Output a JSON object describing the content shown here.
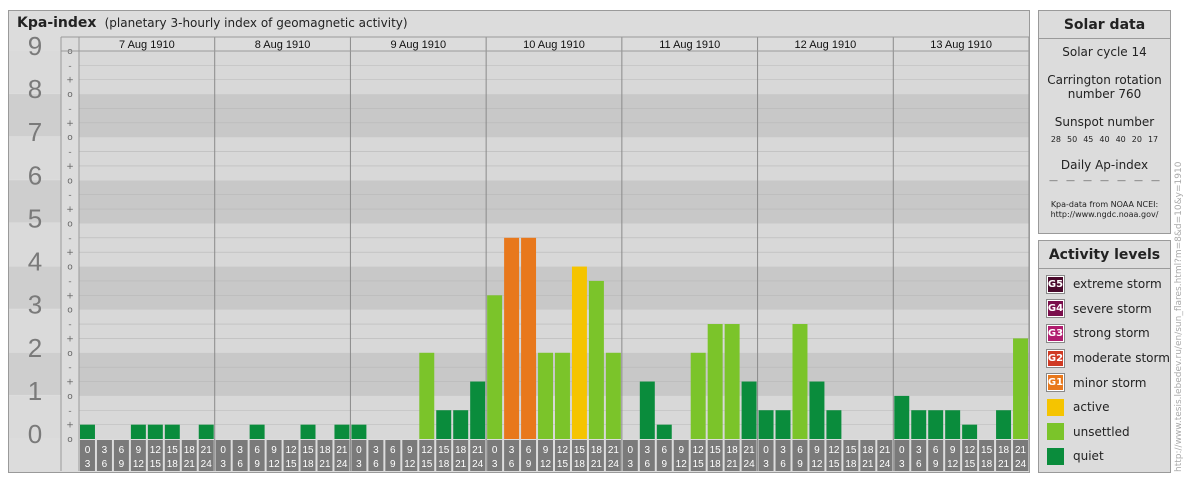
{
  "header": {
    "title": "Kpa-index",
    "subtitle": "(planetary 3-hourly index of geomagnetic activity)"
  },
  "chart_data": {
    "type": "bar",
    "title": "Kpa-index",
    "subtitle": "(planetary 3-hourly index of geomagnetic activity)",
    "ylim": [
      0,
      9
    ],
    "y_ticks": [
      "0",
      "1",
      "2",
      "3",
      "4",
      "5",
      "6",
      "7",
      "8",
      "9"
    ],
    "y_subticks": [
      "o",
      "+",
      "-"
    ],
    "days": [
      "7 Aug 1910",
      "8 Aug 1910",
      "9 Aug 1910",
      "10 Aug 1910",
      "11 Aug 1910",
      "12 Aug 1910",
      "13 Aug 1910"
    ],
    "interval_labels": [
      [
        "0",
        "3"
      ],
      [
        "3",
        "6"
      ],
      [
        "6",
        "9"
      ],
      [
        "9",
        "12"
      ],
      [
        "12",
        "15"
      ],
      [
        "15",
        "18"
      ],
      [
        "18",
        "21"
      ],
      [
        "21",
        "24"
      ]
    ],
    "values": [
      [
        0.333,
        0,
        0,
        0.333,
        0.333,
        0.333,
        0,
        0.333
      ],
      [
        0,
        0,
        0.333,
        0,
        0,
        0.333,
        0,
        0.333
      ],
      [
        0.333,
        0,
        0,
        0,
        2,
        0.667,
        0.667,
        1.333
      ],
      [
        3.333,
        4.667,
        4.667,
        2,
        2,
        4,
        3.667,
        2
      ],
      [
        0,
        1.333,
        0.333,
        0,
        2,
        2.667,
        2.667,
        1.333
      ],
      [
        0.667,
        0.667,
        2.667,
        1.333,
        0.667,
        0,
        0,
        0
      ],
      [
        1,
        0.667,
        0.667,
        0.667,
        0.333,
        0,
        0.667,
        2.333
      ]
    ],
    "colors": {
      "quiet": "#0a8c3c",
      "unsettled": "#7bc42a",
      "active": "#f5c400",
      "minor": "#e8781c"
    },
    "grid": true
  },
  "solar": {
    "title": "Solar data",
    "cycle": "Solar cycle 14",
    "carrington_line1": "Carrington rotation",
    "carrington_line2": "number 760",
    "sunspot_label": "Sunspot number",
    "sunspots": [
      "28",
      "50",
      "45",
      "40",
      "40",
      "20",
      "17"
    ],
    "ap_label": "Daily Ap-index",
    "ap_values": [
      "—",
      "—",
      "—",
      "—",
      "—",
      "—",
      "—"
    ],
    "credit_line1": "Kpa-data from NOAA NCEI:",
    "credit_line2": "http://www.ngdc.noaa.gov/"
  },
  "activity": {
    "title": "Activity levels",
    "items": [
      {
        "code": "G5",
        "label": "extreme storm",
        "color": "#4a0a2c"
      },
      {
        "code": "G4",
        "label": "severe storm",
        "color": "#7a0e4c"
      },
      {
        "code": "G3",
        "label": "strong storm",
        "color": "#b01c6e"
      },
      {
        "code": "G2",
        "label": "moderate storm",
        "color": "#d03a24"
      },
      {
        "code": "G1",
        "label": "minor storm",
        "color": "#e8781c"
      },
      {
        "code": "",
        "label": "active",
        "color": "#f5c400"
      },
      {
        "code": "",
        "label": "unsettled",
        "color": "#7bc42a"
      },
      {
        "code": "",
        "label": "quiet",
        "color": "#0a8c3c"
      }
    ]
  },
  "side_url": "http://www.tesis.lebedev.ru/en/sun_flares.html?m=8&d=10&y=1910"
}
